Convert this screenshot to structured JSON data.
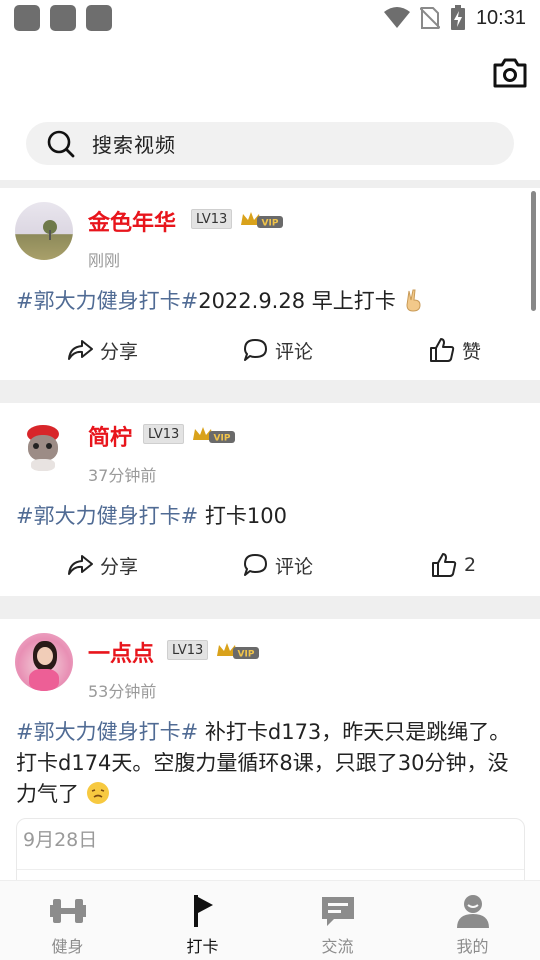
{
  "status_bar": {
    "time": "10:31"
  },
  "header": {
    "camera_icon": "camera-icon"
  },
  "search": {
    "placeholder": "搜索视频"
  },
  "posts": [
    {
      "username": "金色年华",
      "level": "LV13",
      "vip": "VIP",
      "time": "刚刚",
      "tag": "#郭大力健身打卡#",
      "text": "2022.9.28 早上打卡",
      "emoji": "victory-hand",
      "share_label": "分享",
      "comment_label": "评论",
      "like_label": "赞"
    },
    {
      "username": "简柠",
      "level": "LV13",
      "vip": "VIP",
      "time": "37分钟前",
      "tag": "#郭大力健身打卡#",
      "text": " 打卡100",
      "share_label": "分享",
      "comment_label": "评论",
      "like_label": "2"
    },
    {
      "username": "一点点",
      "level": "LV13",
      "vip": "VIP",
      "time": "53分钟前",
      "tag": "#郭大力健身打卡#",
      "text": " 补打卡d173，昨天只是跳绳了。打卡d174天。空腹力量循环8课，只跟了30分钟，没力气了",
      "emoji": "tired-face",
      "card_date": "9月28日"
    }
  ],
  "bottom_nav": {
    "items": [
      {
        "label": "健身",
        "icon": "dumbbell-icon",
        "active": false
      },
      {
        "label": "打卡",
        "icon": "flag-icon",
        "active": true
      },
      {
        "label": "交流",
        "icon": "chat-icon",
        "active": false
      },
      {
        "label": "我的",
        "icon": "person-icon",
        "active": false
      }
    ]
  },
  "colors": {
    "username": "#e8151c",
    "hashtag": "#506b94",
    "vip_gold": "#d9a21b",
    "divider": "#efefef"
  }
}
